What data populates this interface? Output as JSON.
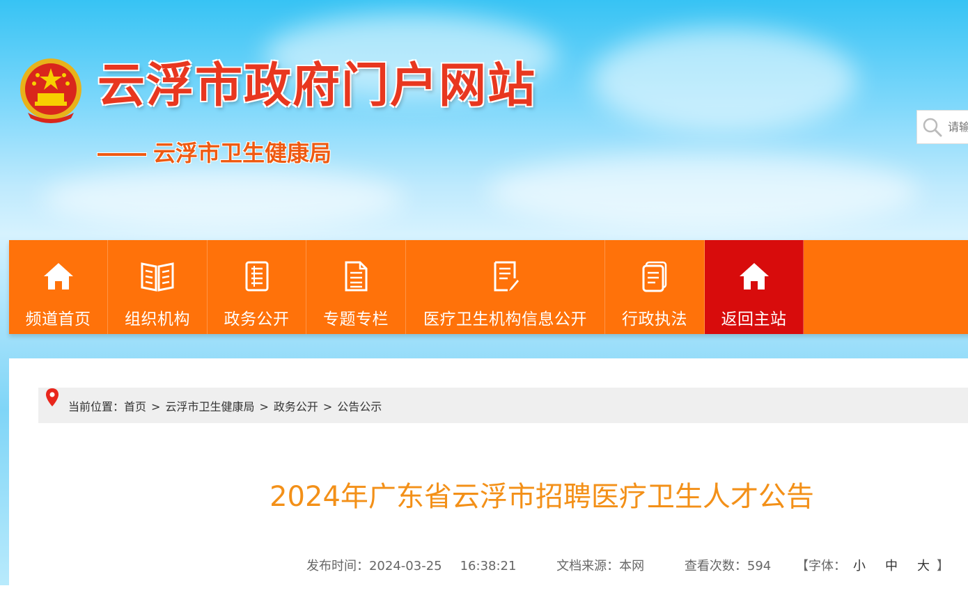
{
  "header": {
    "site_title": "云浮市政府门户网站",
    "dept_name": "云浮市卫生健康局",
    "search_placeholder": "请输入"
  },
  "nav": {
    "items": [
      {
        "label": "频道首页",
        "icon": "home-icon"
      },
      {
        "label": "组织机构",
        "icon": "book-icon"
      },
      {
        "label": "政务公开",
        "icon": "document-list-icon"
      },
      {
        "label": "专题专栏",
        "icon": "notes-icon"
      },
      {
        "label": "医疗卫生机构信息公开",
        "icon": "edit-document-icon"
      },
      {
        "label": "行政执法",
        "icon": "file-icon"
      },
      {
        "label": "返回主站",
        "icon": "home-icon",
        "active": true
      }
    ]
  },
  "breadcrumb": {
    "prefix": "当前位置：",
    "items": [
      "首页",
      "云浮市卫生健康局",
      "政务公开",
      "公告公示"
    ],
    "separator": ">"
  },
  "article": {
    "title": "2024年广东省云浮市招聘医疗卫生人才公告",
    "publish_label": "发布时间：",
    "publish_date": "2024-03-25",
    "publish_time": "16:38:21",
    "source_label": "文档来源：",
    "source": "本网",
    "views_label": "查看次数：",
    "views": "594",
    "font_label_open": "【字体：",
    "font_small": "小",
    "font_medium": "中",
    "font_large": "大",
    "font_label_close": "】"
  },
  "colors": {
    "nav_bg": "#ff720a",
    "nav_active": "#d80c0c",
    "title": "#f39018",
    "site_title": "#e8371f"
  }
}
